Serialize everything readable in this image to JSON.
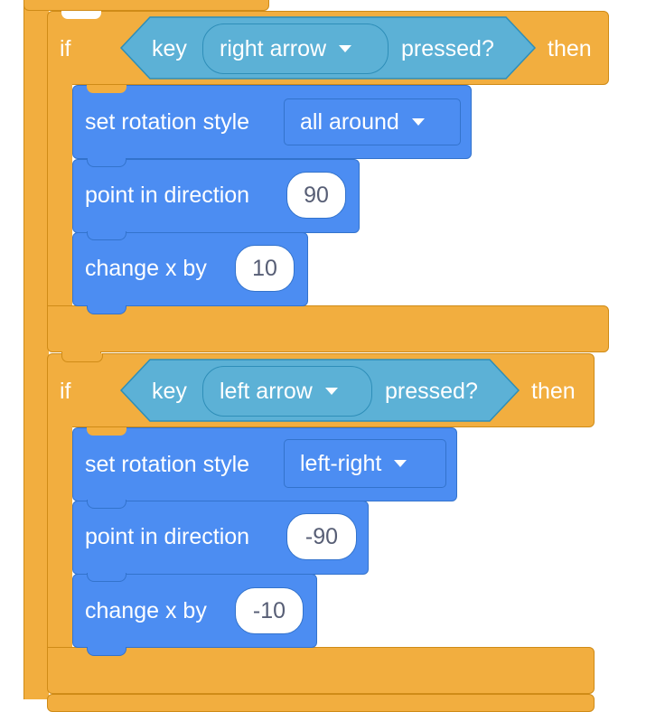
{
  "if_block_1": {
    "if_label": "if",
    "then_label": "then",
    "condition": {
      "key_label": "key",
      "key_value": "right arrow",
      "pressed_label": "pressed?"
    },
    "statements": [
      {
        "label": "set rotation style",
        "menu_value": "all around"
      },
      {
        "label": "point in direction",
        "value": "90"
      },
      {
        "label": "change x by",
        "value": "10"
      }
    ]
  },
  "if_block_2": {
    "if_label": "if",
    "then_label": "then",
    "condition": {
      "key_label": "key",
      "key_value": "left arrow",
      "pressed_label": "pressed?"
    },
    "statements": [
      {
        "label": "set rotation style",
        "menu_value": "left-right"
      },
      {
        "label": "point in direction",
        "value": "-90"
      },
      {
        "label": "change x by",
        "value": "-10"
      }
    ]
  },
  "colors": {
    "control": "#F2AE3F",
    "control_border": "#CF8B17",
    "motion": "#4C8DF2",
    "motion_border": "#3373CC",
    "sensing": "#5CB1D6",
    "sensing_border": "#2E8EB8"
  },
  "icons": {
    "dropdown": "caret-down-icon"
  }
}
